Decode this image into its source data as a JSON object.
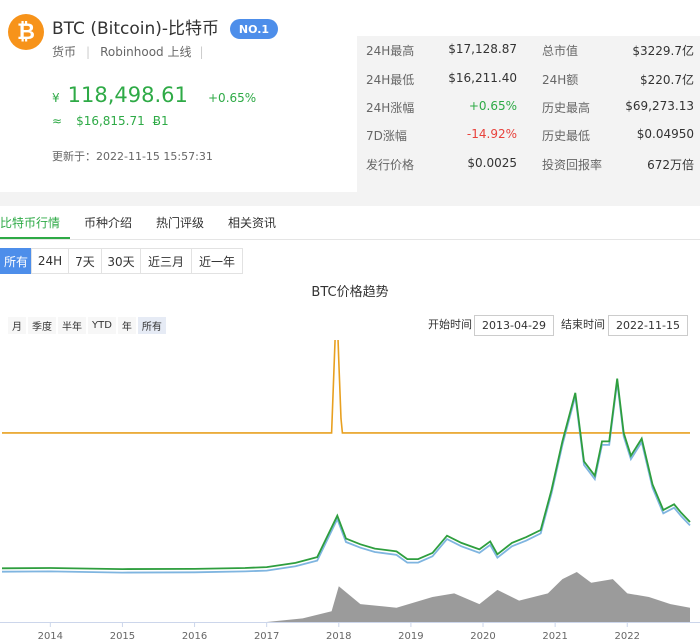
{
  "coin": {
    "logo_icon": "bitcoin-icon",
    "logo_glyph": "₿",
    "title": "BTC (Bitcoin)-比特币",
    "rank": "NO.1",
    "type": "货币",
    "exchange": "Robinhood",
    "listed": "上线",
    "price_cny_symbol": "¥",
    "price_cny": "118,498.61",
    "change_pct": "+0.65%",
    "approx_symbol": "≈",
    "price_usd": "$16,815.71",
    "price_unit": "Ƀ1",
    "updated": "更新于：2022-11-15 15:57:31"
  },
  "stats": {
    "high_24h_label": "24H最高",
    "high_24h": "$17,128.87",
    "low_24h_label": "24H最低",
    "low_24h": "$16,211.40",
    "change_24h_label": "24H涨幅",
    "change_24h": "+0.65%",
    "change_7d_label": "7D涨幅",
    "change_7d": "-14.92%",
    "issue_price_label": "发行价格",
    "issue_price": "$0.0025",
    "market_cap_label": "总市值",
    "market_cap": "$3229.7亿",
    "volume_24h_label": "24H额",
    "volume_24h": "$220.7亿",
    "ath_label": "历史最高",
    "ath": "$69,273.13",
    "atl_label": "历史最低",
    "atl": "$0.04950",
    "roi_label": "投资回报率",
    "roi": "672万倍"
  },
  "tabs": [
    "比特币行情",
    "币种介绍",
    "热门评级",
    "相关资讯"
  ],
  "ranges": [
    "所有",
    "24H",
    "7天",
    "30天",
    "近三月",
    "近一年"
  ],
  "chart_title": "BTC价格趋势",
  "zoom": [
    "月",
    "季度",
    "半年",
    "YTD",
    "年",
    "所有"
  ],
  "date_filter": {
    "start_label": "开始时间",
    "start": "2013-04-29",
    "end_label": "结束时间",
    "end": "2022-11-15"
  },
  "colors": {
    "accent_green": "#2eaa46",
    "accent_blue": "#4d8eea",
    "down_red": "#e8423c",
    "btc_orange": "#f7931a",
    "price_line": "#2e9e3e",
    "price_shadow": "#7fb5e0",
    "flat_line": "#e8a020",
    "volume_area": "#8a8a8a"
  },
  "chart_data": {
    "type": "line",
    "title": "BTC价格趋势",
    "x_tick_labels": [
      "2014",
      "2015",
      "2016",
      "2017",
      "2018",
      "2019",
      "2020",
      "2021",
      "2022"
    ],
    "series": [],
    "price_series": [
      [
        2013.33,
        0.6
      ],
      [
        2014.0,
        0.7
      ],
      [
        2015.0,
        0.3
      ],
      [
        2016.0,
        0.4
      ],
      [
        2016.7,
        0.7
      ],
      [
        2017.0,
        1.0
      ],
      [
        2017.4,
        2.5
      ],
      [
        2017.7,
        4.5
      ],
      [
        2017.98,
        19.0
      ],
      [
        2018.1,
        11.0
      ],
      [
        2018.3,
        9.0
      ],
      [
        2018.5,
        7.5
      ],
      [
        2018.8,
        6.5
      ],
      [
        2018.95,
        3.8
      ],
      [
        2019.1,
        3.8
      ],
      [
        2019.3,
        6.0
      ],
      [
        2019.5,
        12.0
      ],
      [
        2019.7,
        9.5
      ],
      [
        2019.95,
        7.2
      ],
      [
        2020.1,
        10.0
      ],
      [
        2020.2,
        5.5
      ],
      [
        2020.4,
        9.5
      ],
      [
        2020.6,
        11.5
      ],
      [
        2020.8,
        14.0
      ],
      [
        2020.95,
        28.0
      ],
      [
        2021.1,
        45.0
      ],
      [
        2021.28,
        62.0
      ],
      [
        2021.4,
        38.0
      ],
      [
        2021.55,
        33.0
      ],
      [
        2021.65,
        45.0
      ],
      [
        2021.75,
        45.0
      ],
      [
        2021.86,
        67.0
      ],
      [
        2021.95,
        48.0
      ],
      [
        2022.05,
        40.0
      ],
      [
        2022.2,
        46.0
      ],
      [
        2022.35,
        30.0
      ],
      [
        2022.5,
        21.0
      ],
      [
        2022.65,
        23.0
      ],
      [
        2022.75,
        20.0
      ],
      [
        2022.87,
        16.8
      ]
    ],
    "flat_series": [
      [
        2013.33,
        48.0
      ],
      [
        2017.9,
        48.0
      ],
      [
        2017.97,
        95.0
      ],
      [
        2018.0,
        73.0
      ],
      [
        2018.03,
        53.0
      ],
      [
        2018.05,
        48.0
      ],
      [
        2022.87,
        48.0
      ]
    ],
    "volume_series": [
      [
        2013.33,
        0
      ],
      [
        2017.0,
        0
      ],
      [
        2017.5,
        1
      ],
      [
        2017.9,
        3
      ],
      [
        2018.0,
        10
      ],
      [
        2018.3,
        5
      ],
      [
        2018.8,
        4
      ],
      [
        2019.3,
        7
      ],
      [
        2019.6,
        8
      ],
      [
        2019.95,
        5
      ],
      [
        2020.2,
        9
      ],
      [
        2020.5,
        6
      ],
      [
        2020.9,
        8
      ],
      [
        2021.1,
        12
      ],
      [
        2021.3,
        14
      ],
      [
        2021.5,
        11
      ],
      [
        2021.8,
        12
      ],
      [
        2022.0,
        8
      ],
      [
        2022.3,
        7
      ],
      [
        2022.6,
        5
      ],
      [
        2022.87,
        4
      ]
    ],
    "x_range": [
      2013.33,
      2022.87
    ]
  }
}
